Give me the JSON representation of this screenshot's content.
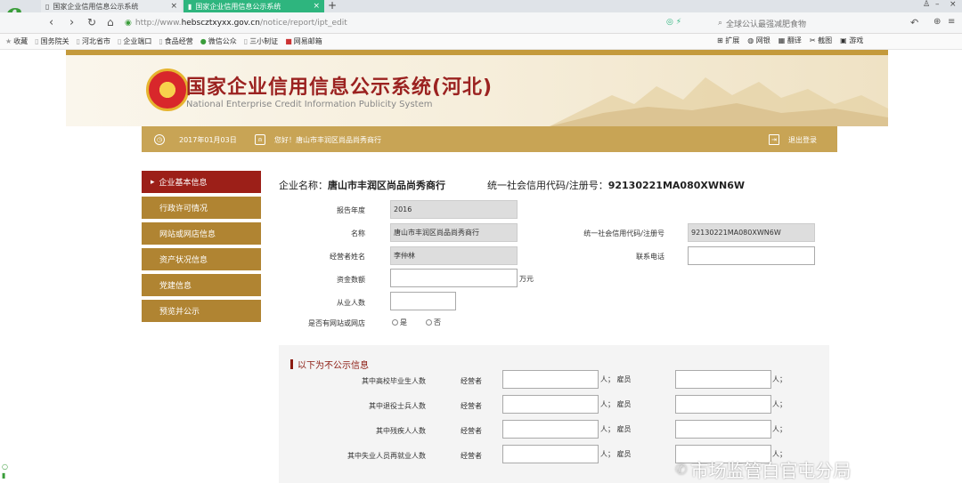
{
  "browser": {
    "tabs": [
      {
        "label": "国家企业信用信息公示系统",
        "active": false
      },
      {
        "label": "国家企业信用信息公示系统",
        "active": true
      }
    ],
    "new_tab": "+",
    "url_prefix": "http://www.",
    "url_domain": "hebscztxyxx.gov.cn",
    "url_path": "/notice/report/ipt_edit",
    "search_placeholder": "全球公认最强减肥食物",
    "bookmarks": [
      "收藏",
      "国务院关",
      "河北省市",
      "企业端口",
      "食品经营",
      "微信公众",
      "三小制证",
      "网易邮箱"
    ],
    "tools": [
      "扩展",
      "网银",
      "翻译",
      "截图",
      "游戏"
    ],
    "accent": "#2eb57e"
  },
  "header": {
    "title": "国家企业信用信息公示系统(河北)",
    "subtitle": "National Enterprise Credit Information Publicity System",
    "date": "2017年01月03日",
    "greeting": "您好！唐山市丰润区尚品尚秀商行",
    "logout": "退出登录"
  },
  "sidebar": {
    "items": [
      {
        "label": "企业基本信息",
        "active": true
      },
      {
        "label": "行政许可情况"
      },
      {
        "label": "网站或网店信息"
      },
      {
        "label": "资产状况信息"
      },
      {
        "label": "党建信息"
      },
      {
        "label": "预览并公示"
      }
    ]
  },
  "main": {
    "company_label": "企业名称：",
    "company_name": "唐山市丰润区尚品尚秀商行",
    "credit_label": "统一社会信用代码/注册号：",
    "credit_code": "92130221MA080XWN6W",
    "fields": {
      "year_label": "报告年度",
      "year_value": "2016",
      "name_label": "名称",
      "name_value": "唐山市丰润区尚品尚秀商行",
      "code_label": "统一社会信用代码/注册号",
      "code_value": "92130221MA080XWN6W",
      "operator_label": "经营者姓名",
      "operator_value": "李仲林",
      "phone_label": "联系电话",
      "phone_value": "",
      "capital_label": "资金数额",
      "capital_value": "",
      "capital_unit": "万元",
      "staff_label": "从业人数",
      "staff_value": "",
      "website_label": "是否有网站或网店",
      "yes": "是",
      "no": "否"
    }
  },
  "panel": {
    "title": "以下为不公示信息",
    "operator_col": "经营者",
    "unit_person": "人；",
    "employee": "雇员",
    "unit_end": "人；",
    "rows": [
      "其中高校毕业生人数",
      "其中退役士兵人数",
      "其中残疾人人数",
      "其中失业人员再就业人数"
    ]
  },
  "watermark": "市场监管白官屯分局"
}
